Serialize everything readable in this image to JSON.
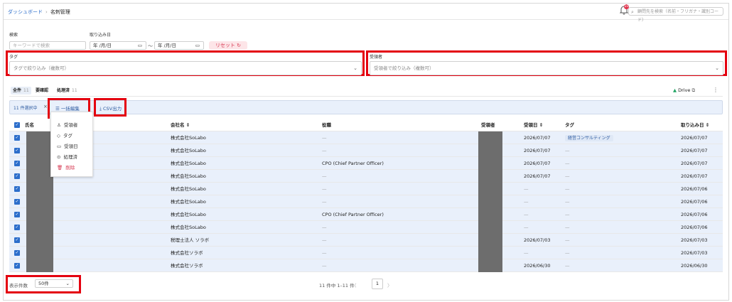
{
  "breadcrumb": {
    "parent": "ダッシュボード",
    "sep": "›",
    "current": "名刺管理"
  },
  "notifications": {
    "count": "10"
  },
  "global_search": {
    "placeholder": "顧問先を検索（名前・フリガナ・識別コード）"
  },
  "filters": {
    "search_label": "検索",
    "search_placeholder": "キーワードで検索",
    "date_label": "取り込み日",
    "date_from": "年 /月/日",
    "date_to": "年 /月/日",
    "date_sep": "〜",
    "reset_label": "リセット",
    "tag_label": "タグ",
    "tag_placeholder": "タグで絞り込み（複数可）",
    "receiver_label": "受領者",
    "receiver_placeholder": "受領者で絞り込み（複数可）"
  },
  "tabs": [
    {
      "label": "全件",
      "count": "11"
    },
    {
      "label": "要確認",
      "count": ""
    },
    {
      "label": "処理済",
      "count": "11"
    }
  ],
  "drive_label": "Drive",
  "bulk": {
    "selected": "11 件選択中",
    "edit_label": "一括編集",
    "csv_label": "CSV出力"
  },
  "bulk_menu": [
    {
      "icon": "person-icon",
      "glyph": "♙",
      "label": "受領者"
    },
    {
      "icon": "tag-icon",
      "glyph": "◇",
      "label": "タグ"
    },
    {
      "icon": "calendar-icon",
      "glyph": "▭",
      "label": "受領日"
    },
    {
      "icon": "check-circle-icon",
      "glyph": "⊙",
      "label": "処理済"
    },
    {
      "icon": "trash-icon",
      "glyph": "🗑",
      "label": "削除"
    }
  ],
  "columns": {
    "name": "氏名",
    "company": "会社名 ⇕",
    "title": "役職",
    "receiver": "受領者",
    "received_date": "受領日 ⇕",
    "tag": "タグ",
    "imported": "取り込み日 ⇕"
  },
  "rows": [
    {
      "name": "",
      "company": "株式会社SoLabo",
      "title": "—",
      "received": "2026/07/07",
      "tag": "経営コンサルティング",
      "imported": "2026/07/07"
    },
    {
      "name": "",
      "company": "株式会社SoLabo",
      "title": "—",
      "received": "2026/07/07",
      "tag": "",
      "imported": "2026/07/07"
    },
    {
      "name": "",
      "company": "株式会社SoLabo",
      "title": "CPO (Chief Partner Officer)",
      "received": "2026/07/07",
      "tag": "",
      "imported": "2026/07/07"
    },
    {
      "name": "",
      "company": "株式会社SoLabo",
      "title": "—",
      "received": "2026/07/07",
      "tag": "",
      "imported": "2026/07/07"
    },
    {
      "name": "",
      "company": "株式会社SoLabo",
      "title": "—",
      "received": "—",
      "tag": "",
      "imported": "2026/07/06"
    },
    {
      "name": "",
      "company": "株式会社SoLabo",
      "title": "—",
      "received": "—",
      "tag": "",
      "imported": "2026/07/06"
    },
    {
      "name": "",
      "company": "株式会社SoLabo",
      "title": "CPO (Chief Partner Officer)",
      "received": "—",
      "tag": "",
      "imported": "2026/07/06"
    },
    {
      "name": "",
      "company": "株式会社SoLabo",
      "title": "—",
      "received": "—",
      "tag": "",
      "imported": "2026/07/06"
    },
    {
      "name": "",
      "company": "税理士法人 ソラボ",
      "title": "—",
      "received": "2026/07/03",
      "tag": "",
      "imported": "2026/07/03"
    },
    {
      "name": "",
      "company": "株式会社ソラボ",
      "title": "—",
      "received": "—",
      "tag": "",
      "imported": "2026/07/03"
    },
    {
      "name": "",
      "company": "株式会社ソラボ",
      "title": "—",
      "received": "2026/06/30",
      "tag": "",
      "imported": "2026/06/30"
    }
  ],
  "footer": {
    "per_page_label": "表示件数",
    "per_page_value": "50件",
    "summary": "11 件中 1–11 件",
    "prev": "〈",
    "page": "1",
    "next": "〉"
  },
  "colors": {
    "accent": "#2c6ecb",
    "highlight": "#e4000f",
    "selected_row": "#e9f0fb"
  }
}
